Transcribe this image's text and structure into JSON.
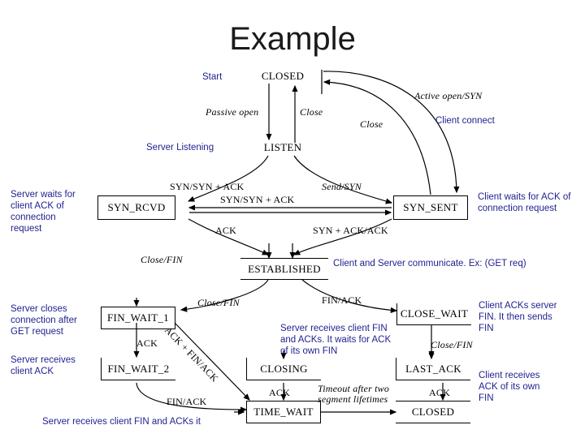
{
  "slide": {
    "title": "Example"
  },
  "states": [
    {
      "id": "closed-top",
      "label": "CLOSED"
    },
    {
      "id": "listen",
      "label": "LISTEN"
    },
    {
      "id": "syn-rcvd",
      "label": "SYN_RCVD"
    },
    {
      "id": "syn-sent",
      "label": "SYN_SENT"
    },
    {
      "id": "established",
      "label": "ESTABLISHED"
    },
    {
      "id": "fin-wait-1",
      "label": "FIN_WAIT_1"
    },
    {
      "id": "close-wait",
      "label": "CLOSE_WAIT"
    },
    {
      "id": "fin-wait-2",
      "label": "FIN_WAIT_2"
    },
    {
      "id": "closing",
      "label": "CLOSING"
    },
    {
      "id": "last-ack",
      "label": "LAST_ACK"
    },
    {
      "id": "time-wait",
      "label": "TIME_WAIT"
    },
    {
      "id": "closed-bottom",
      "label": "CLOSED"
    }
  ],
  "transitions": {
    "passive_open": "Passive open",
    "close_top": "Close",
    "active_open_syn": "Active open/SYN",
    "close_curve": "Close",
    "syn_synack_left": "SYN/SYN + ACK",
    "send_syn": "Send/SYN",
    "syn_synack_mid": "SYN/SYN + ACK",
    "ack_left": "ACK",
    "syn_ack_ack": "SYN + ACK/ACK",
    "close_fin_left": "Close/FIN",
    "close_fin_mid": "Close/FIN",
    "fin_ack_right": "FIN/ACK",
    "ack_finwait": "ACK",
    "ack_fin_ack_diag": "ACK + FIN/ACK",
    "fin_ack_bottom": "FIN/ACK",
    "close_fin_right": "Close/FIN",
    "ack_closing": "ACK",
    "ack_lastack": "ACK",
    "timeout": "Timeout after two segment lifetimes"
  },
  "annotations": {
    "start": "Start",
    "client_connect": "Client connect",
    "server_listening": "Server Listening",
    "server_waits_ack": "Server waits for\nclient ACK of\nconnection\nrequest",
    "client_waits_ack": "Client waits for ACK of\nconnection request",
    "client_server_comm": "Client and Server communicate. Ex: (GET req)",
    "server_closes": "Server closes\nconnection after\nGET request",
    "client_acks_server": "Client ACKs server\nFIN. It then sends\nFIN",
    "server_receives_fin": "Server receives client FIN\nand ACKs. It waits for ACK\nof its own FIN",
    "server_receives_ack": "Server receives\nclient ACK",
    "client_receives_ack": "Client receives\nACK of its own\nFIN",
    "server_receives_fin_acks": "Server receives client FIN and ACKs it"
  },
  "colors": {
    "annotation": "#1f1f8f",
    "diagram": "#000000",
    "title": "#1a1a1a",
    "background": "#ffffff"
  }
}
